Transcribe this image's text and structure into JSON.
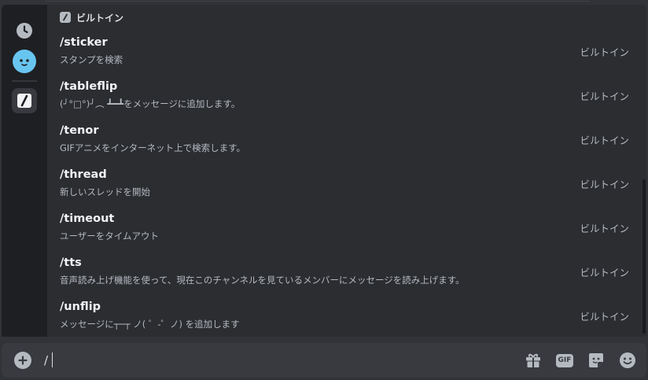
{
  "section": {
    "title": "ビルトイン"
  },
  "commands": [
    {
      "name": "/sticker",
      "description": "スタンプを検索",
      "source": "ビルトイン"
    },
    {
      "name": "/tableflip",
      "description": "(╯°□°)╯︵ ┻━┻をメッセージに追加します。",
      "source": "ビルトイン"
    },
    {
      "name": "/tenor",
      "description": "GIFアニメをインターネット上で検索します。",
      "source": "ビルトイン"
    },
    {
      "name": "/thread",
      "description": "新しいスレッドを開始",
      "source": "ビルトイン"
    },
    {
      "name": "/timeout",
      "description": "ユーザーをタイムアウト",
      "source": "ビルトイン"
    },
    {
      "name": "/tts",
      "description": "音声読み上げ機能を使って、現在このチャンネルを見ているメンバーにメッセージを読み上げます。",
      "source": "ビルトイン"
    },
    {
      "name": "/unflip",
      "description": "メッセージに┬─┬ ノ( ゜-゜ノ) を追加します",
      "source": "ビルトイン"
    }
  ],
  "composer": {
    "value": "/",
    "gif_label": "GIF"
  },
  "icons": {
    "rail": [
      "clock-icon",
      "bot-avatar-icon",
      "builtin-slash-icon"
    ],
    "toolbar": [
      "add-icon",
      "gift-icon",
      "gif-icon",
      "sticker-icon",
      "emoji-icon"
    ]
  },
  "colors": {
    "accent_avatar": "#68c5f0",
    "popup_bg": "#2b2d31",
    "rail_bg": "#1e1f22",
    "composer_bg": "#383a40"
  }
}
